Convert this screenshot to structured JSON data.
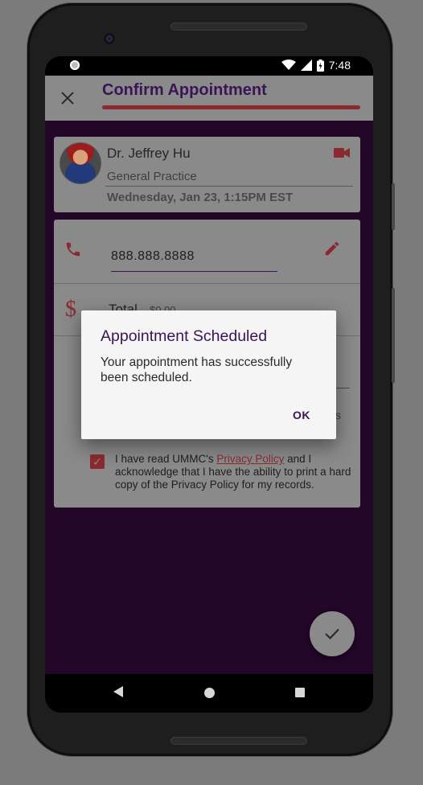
{
  "status_bar": {
    "time": "7:48"
  },
  "app_bar": {
    "title": "Confirm Appointment"
  },
  "doctor": {
    "name": "Dr. Jeffrey Hu",
    "specialty": "General Practice",
    "datetime": "Wednesday, Jan 23, 1:15PM EST"
  },
  "contact": {
    "phone_value": "888.888.8888"
  },
  "payment": {
    "total_label": "Total",
    "total_value": "$0.00"
  },
  "acknowledgement": {
    "text_before": "I have read UMMC's ",
    "link": "Privacy Policy",
    "text_after": " and I acknowledge that I have the ability to print a hard copy of the Privacy Policy for my records.",
    "field_suffix": "s"
  },
  "dialog": {
    "title": "Appointment Scheduled",
    "message": "Your appointment has successfully been scheduled.",
    "ok_label": "OK"
  },
  "colors": {
    "accent": "#3a1454",
    "brand_red": "#8a2a2f",
    "background_purple": "#220728"
  },
  "icons": [
    "close-icon",
    "video-camera-icon",
    "phone-icon",
    "edit-pencil-icon",
    "dollar-icon",
    "checkbox-checked-icon",
    "checkmark-icon",
    "nav-back-icon",
    "nav-home-icon",
    "nav-recents-icon",
    "wifi-icon",
    "signal-icon",
    "battery-icon"
  ]
}
